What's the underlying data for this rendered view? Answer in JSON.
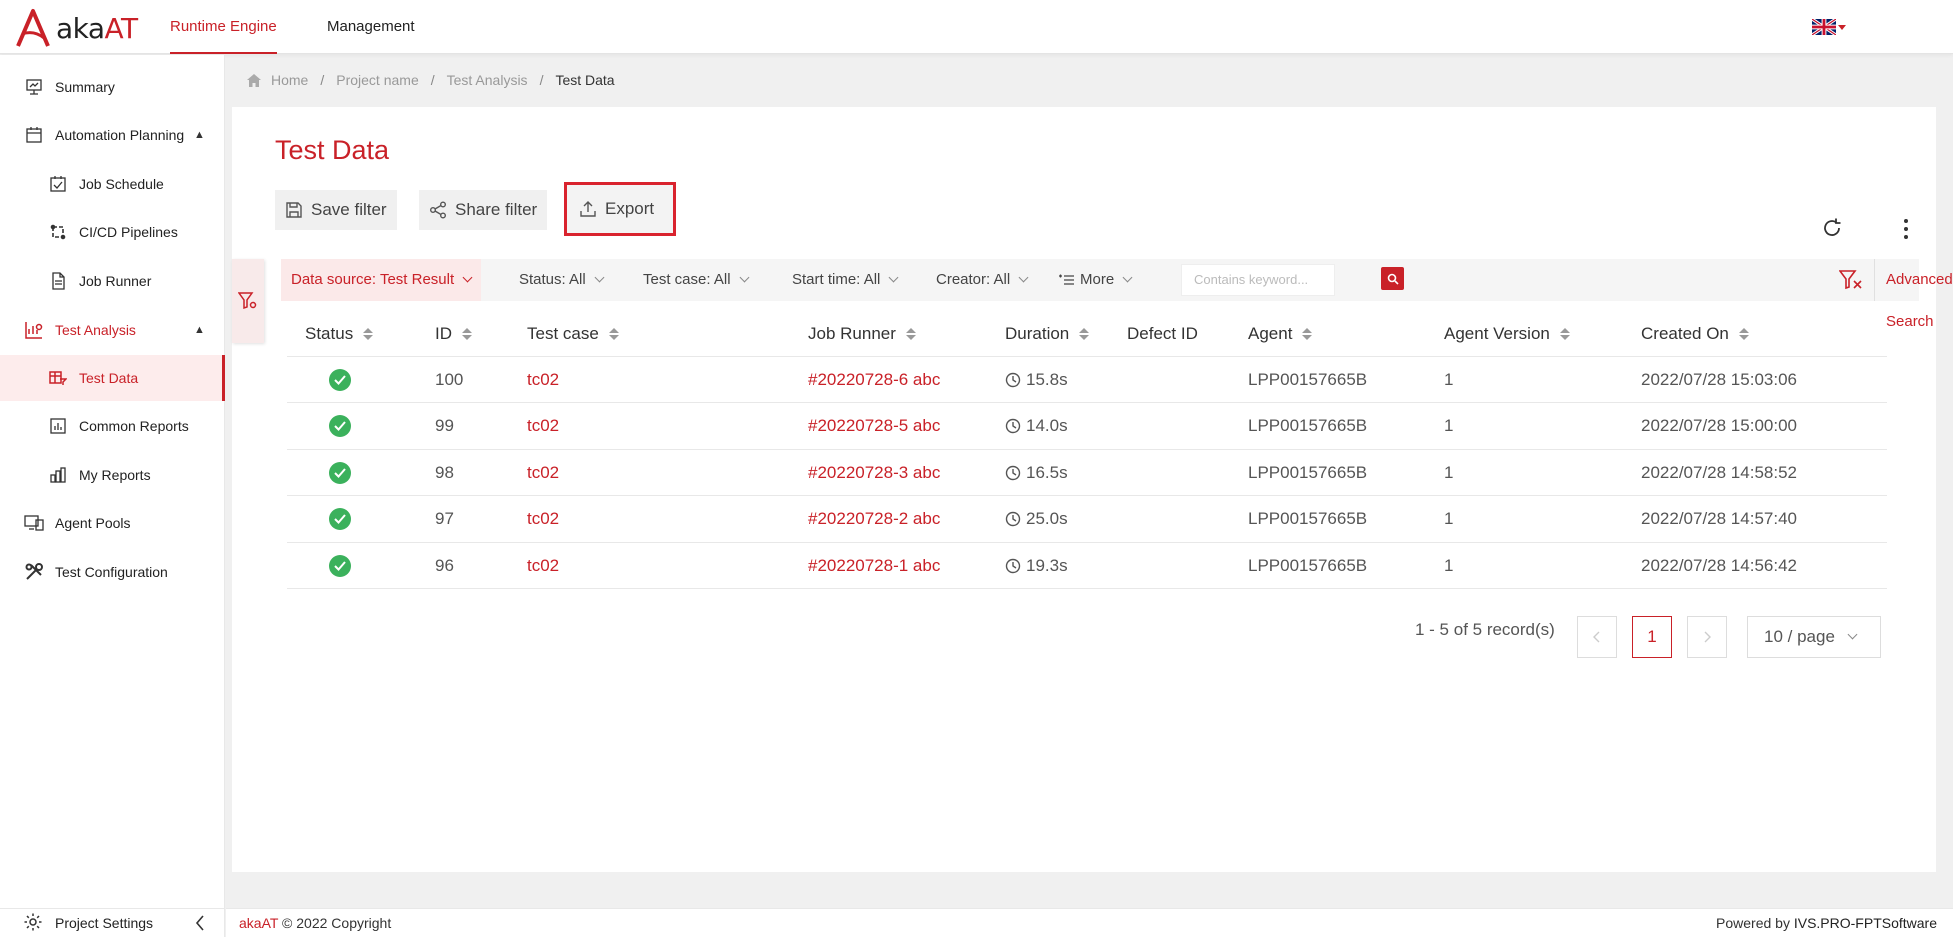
{
  "app": {
    "logo_text_1": "aka",
    "logo_text_2": "AT",
    "brand_color": "#c92128"
  },
  "header": {
    "tabs": [
      {
        "label": "Runtime Engine",
        "active": true
      },
      {
        "label": "Management",
        "active": false
      }
    ],
    "language_icon": "uk-flag-icon"
  },
  "sidebar": {
    "items": [
      {
        "label": "Summary",
        "icon": "presentation-icon"
      },
      {
        "label": "Automation Planning",
        "icon": "calendar-icon"
      },
      {
        "label": "Job Schedule",
        "icon": "calendar-check-icon"
      },
      {
        "label": "CI/CD Pipelines",
        "icon": "pipeline-icon"
      },
      {
        "label": "Job Runner",
        "icon": "document-icon"
      },
      {
        "label": "Test Analysis",
        "icon": "analysis-icon"
      },
      {
        "label": "Test Data",
        "icon": "table-filter-icon"
      },
      {
        "label": "Common Reports",
        "icon": "bar-chart-icon"
      },
      {
        "label": "My Reports",
        "icon": "bar-chart-icon"
      },
      {
        "label": "Agent Pools",
        "icon": "monitor-icon"
      },
      {
        "label": "Test Configuration",
        "icon": "tools-icon"
      }
    ],
    "footer_label": "Project Settings"
  },
  "breadcrumb": {
    "items": [
      "Home",
      "Project name",
      "Test Analysis",
      "Test Data"
    ]
  },
  "page": {
    "title": "Test Data",
    "buttons": {
      "save_filter": "Save filter",
      "share_filter": "Share filter",
      "export": "Export"
    }
  },
  "filters": {
    "data_source": "Data source: Test Result",
    "status": "Status: All",
    "test_case": "Test case: All",
    "start_time": "Start time: All",
    "creator": "Creator: All",
    "more": "More",
    "search_placeholder": "Contains keyword...",
    "advanced_search": "Advanced Search"
  },
  "table": {
    "columns": [
      "Status",
      "ID",
      "Test case",
      "Job Runner",
      "Duration",
      "Defect ID",
      "Agent",
      "Agent Version",
      "Created On"
    ],
    "rows": [
      {
        "status": "passed",
        "id": "100",
        "test_case": "tc02",
        "job_runner": "#20220728-6 abc",
        "duration": "15.8s",
        "defect_id": "",
        "agent": "LPP00157665B",
        "agent_version": "1",
        "created_on": "2022/07/28 15:03:06"
      },
      {
        "status": "passed",
        "id": "99",
        "test_case": "tc02",
        "job_runner": "#20220728-5 abc",
        "duration": "14.0s",
        "defect_id": "",
        "agent": "LPP00157665B",
        "agent_version": "1",
        "created_on": "2022/07/28 15:00:00"
      },
      {
        "status": "passed",
        "id": "98",
        "test_case": "tc02",
        "job_runner": "#20220728-3 abc",
        "duration": "16.5s",
        "defect_id": "",
        "agent": "LPP00157665B",
        "agent_version": "1",
        "created_on": "2022/07/28 14:58:52"
      },
      {
        "status": "passed",
        "id": "97",
        "test_case": "tc02",
        "job_runner": "#20220728-2 abc",
        "duration": "25.0s",
        "defect_id": "",
        "agent": "LPP00157665B",
        "agent_version": "1",
        "created_on": "2022/07/28 14:57:40"
      },
      {
        "status": "passed",
        "id": "96",
        "test_case": "tc02",
        "job_runner": "#20220728-1 abc",
        "duration": "19.3s",
        "defect_id": "",
        "agent": "LPP00157665B",
        "agent_version": "1",
        "created_on": "2022/07/28 14:56:42"
      }
    ]
  },
  "pagination": {
    "record_text": "1 - 5 of 5 record(s)",
    "current_page": "1",
    "page_size": "10 / page"
  },
  "footer": {
    "brand": "akaAT",
    "copyright": " © 2022 Copyright",
    "powered_prefix": "Powered by ",
    "powered_by": "IVS.PRO-FPTSoftware"
  }
}
